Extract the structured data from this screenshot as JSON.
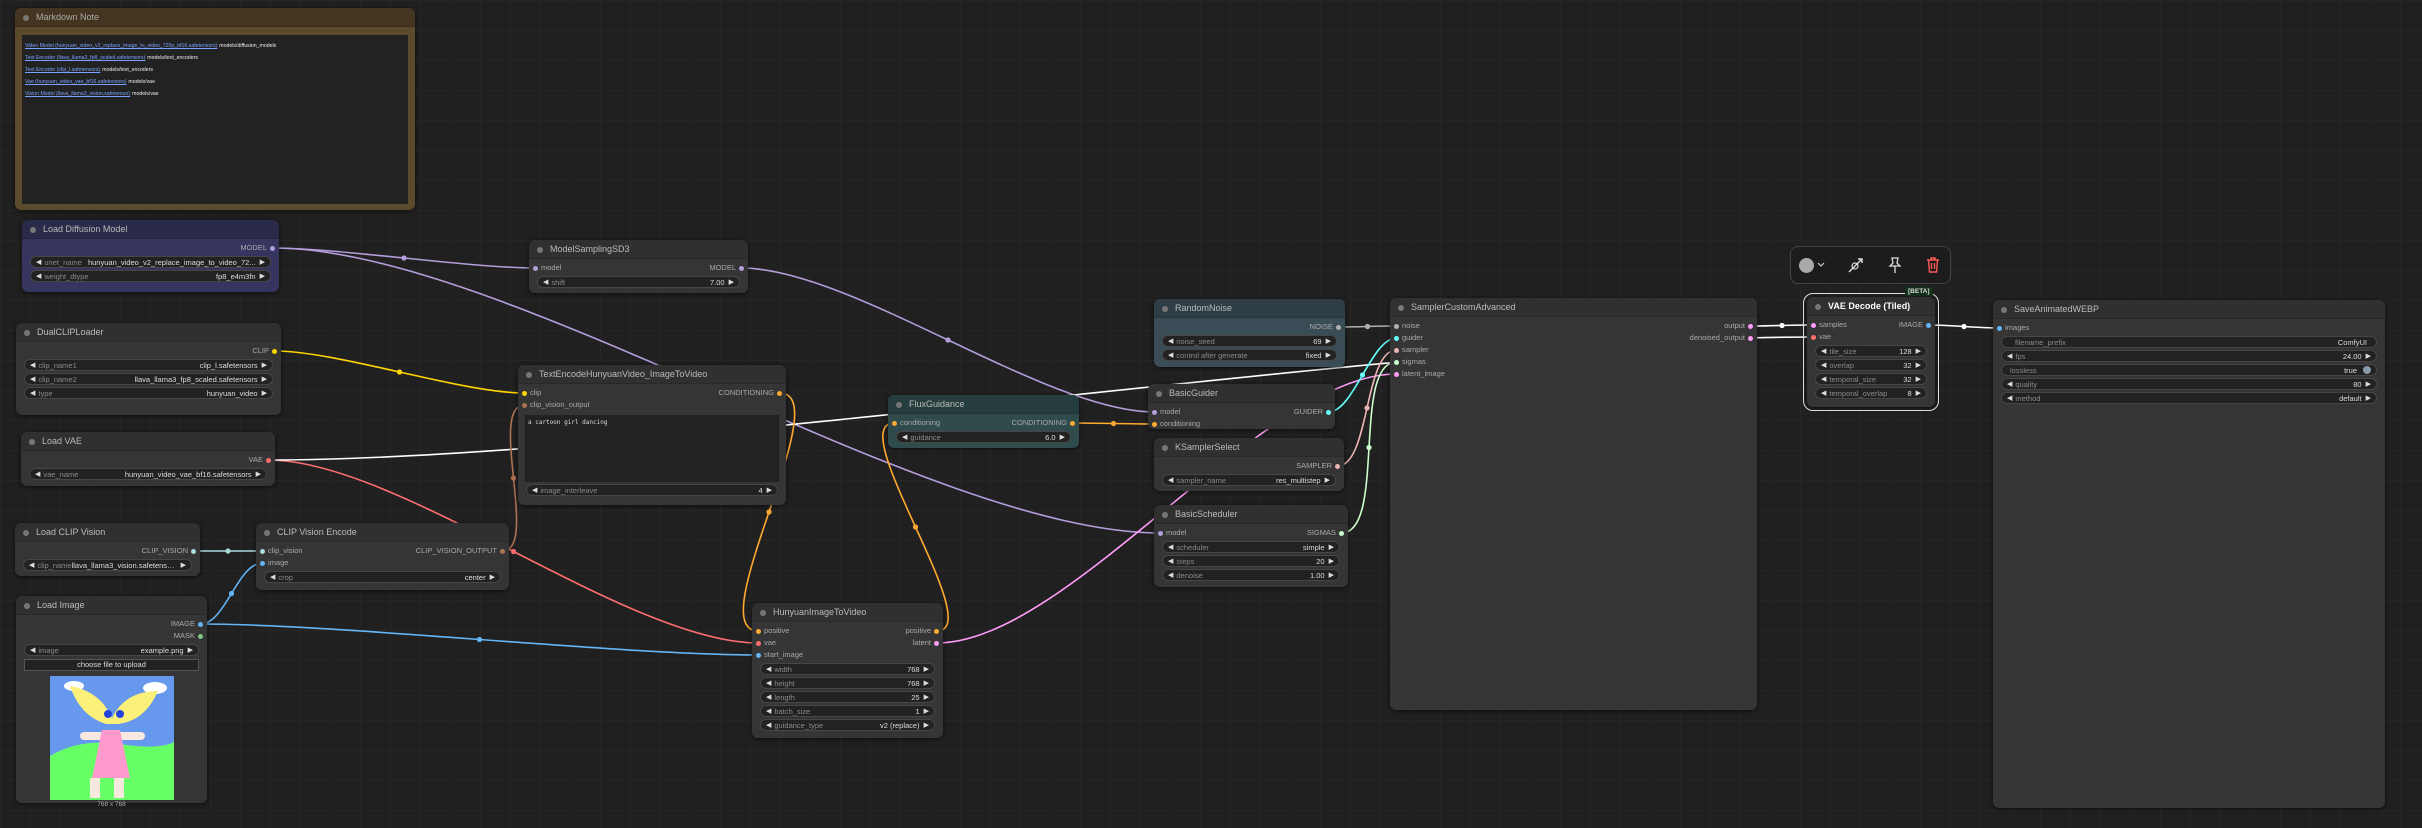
{
  "markdown_note": {
    "title": "Markdown Note",
    "lines": [
      {
        "link": "Video Model (hunyuan_video_v2_replace_image_to_video_720p_bf16.safetensors)",
        "path": "models/diffusion_models"
      },
      {
        "link": "Text Encoder (llava_llama3_fp8_scaled.safetensors)",
        "path": "models/text_encoders"
      },
      {
        "link": "Text Encoder (clip_l.safetensors)",
        "path": "models/text_encoders"
      },
      {
        "link": "Vae (hunyuan_video_vae_bf16.safetensors)",
        "path": "models/vae"
      },
      {
        "link": "Vision Model (llava_llama3_vision.safetensor)",
        "path": "models/vae"
      }
    ]
  },
  "toolbar": {
    "color_icon": "color-circle",
    "bypass_icon": "bypass-wand",
    "pin_icon": "pin",
    "delete_icon": "trash"
  },
  "badge": "[BETA]",
  "nodes": [
    {
      "id": "load-diffusion-model",
      "title": "Load Diffusion Model",
      "theme": "blue",
      "inputs": [],
      "outputs": [
        {
          "name": "MODEL",
          "type": "MODEL"
        }
      ],
      "widgets": [
        {
          "kind": "combo",
          "label": "unet_name",
          "value": "hunyuan_video_v2_replace_image_to_video_72..."
        },
        {
          "kind": "combo",
          "label": "weight_dtype",
          "value": "fp8_e4m3fn"
        }
      ]
    },
    {
      "id": "dual-clip-loader",
      "title": "DualCLIPLoader",
      "inputs": [],
      "outputs": [
        {
          "name": "CLIP",
          "type": "CLIP"
        }
      ],
      "widgets": [
        {
          "kind": "combo",
          "label": "clip_name1",
          "value": "clip_l.safetensors"
        },
        {
          "kind": "combo",
          "label": "clip_name2",
          "value": "llava_llama3_fp8_scaled.safetensors"
        },
        {
          "kind": "combo",
          "label": "type",
          "value": "hunyuan_video"
        }
      ]
    },
    {
      "id": "load-vae",
      "title": "Load VAE",
      "inputs": [],
      "outputs": [
        {
          "name": "VAE",
          "type": "VAE"
        }
      ],
      "widgets": [
        {
          "kind": "combo",
          "label": "vae_name",
          "value": "hunyuan_video_vae_bf16.safetensors"
        }
      ]
    },
    {
      "id": "load-clip-vision",
      "title": "Load CLIP Vision",
      "inputs": [],
      "outputs": [
        {
          "name": "CLIP_VISION",
          "type": "CLIP_VISION"
        }
      ],
      "widgets": [
        {
          "kind": "combo",
          "label": "clip_name",
          "value": "llava_llama3_vision.safetensors"
        }
      ]
    },
    {
      "id": "clip-vision-encode",
      "title": "CLIP Vision Encode",
      "inputs": [
        {
          "name": "clip_vision",
          "type": "CLIP_VISION"
        },
        {
          "name": "image",
          "type": "IMAGE"
        }
      ],
      "outputs": [
        {
          "name": "CLIP_VISION_OUTPUT",
          "type": "CLIP_VISION_OUTPUT"
        }
      ],
      "widgets": [
        {
          "kind": "combo",
          "label": "crop",
          "value": "center"
        }
      ]
    },
    {
      "id": "load-image",
      "title": "Load Image",
      "inputs": [],
      "outputs": [
        {
          "name": "IMAGE",
          "type": "IMAGE"
        },
        {
          "name": "MASK",
          "type": "MASK"
        }
      ],
      "widgets": [
        {
          "kind": "combo",
          "label": "image",
          "value": "example.png"
        },
        {
          "kind": "button",
          "label": "choose file to upload"
        },
        {
          "kind": "preview",
          "label": "768 x 768"
        }
      ]
    },
    {
      "id": "model-sampling-sd3",
      "title": "ModelSamplingSD3",
      "inputs": [
        {
          "name": "model",
          "type": "MODEL"
        }
      ],
      "outputs": [
        {
          "name": "MODEL",
          "type": "MODEL"
        }
      ],
      "widgets": [
        {
          "kind": "number",
          "label": "shift",
          "value": "7.00"
        }
      ]
    },
    {
      "id": "text-encode-hunyuan",
      "title": "TextEncodeHunyuanVideo_ImageToVideo",
      "inputs": [
        {
          "name": "clip",
          "type": "CLIP"
        },
        {
          "name": "clip_vision_output",
          "type": "CLIP_VISION_OUTPUT"
        }
      ],
      "outputs": [
        {
          "name": "CONDITIONING",
          "type": "CONDITIONING"
        }
      ],
      "widgets": [
        {
          "kind": "textarea",
          "value": "a cartoon girl dancing"
        },
        {
          "kind": "number",
          "label": "image_interleave",
          "value": "4"
        }
      ]
    },
    {
      "id": "hunyuan-image-to-video",
      "title": "HunyuanImageToVideo",
      "inputs": [
        {
          "name": "positive",
          "type": "CONDITIONING"
        },
        {
          "name": "vae",
          "type": "VAE"
        },
        {
          "name": "start_image",
          "type": "IMAGE"
        }
      ],
      "outputs": [
        {
          "name": "positive",
          "type": "CONDITIONING"
        },
        {
          "name": "latent",
          "type": "LATENT"
        }
      ],
      "widgets": [
        {
          "kind": "number",
          "label": "width",
          "value": "768"
        },
        {
          "kind": "number",
          "label": "height",
          "value": "768"
        },
        {
          "kind": "number",
          "label": "length",
          "value": "25"
        },
        {
          "kind": "number",
          "label": "batch_size",
          "value": "1"
        },
        {
          "kind": "combo",
          "label": "guidance_type",
          "value": "v2 (replace)"
        }
      ]
    },
    {
      "id": "flux-guidance",
      "title": "FluxGuidance",
      "theme": "teal",
      "inputs": [
        {
          "name": "conditioning",
          "type": "CONDITIONING"
        }
      ],
      "outputs": [
        {
          "name": "CONDITIONING",
          "type": "CONDITIONING"
        }
      ],
      "widgets": [
        {
          "kind": "number",
          "label": "guidance",
          "value": "6.0"
        }
      ]
    },
    {
      "id": "random-noise",
      "title": "RandomNoise",
      "theme": "slate",
      "inputs": [],
      "outputs": [
        {
          "name": "NOISE",
          "type": "NOISE"
        }
      ],
      "widgets": [
        {
          "kind": "number",
          "label": "noise_seed",
          "value": "69"
        },
        {
          "kind": "combo",
          "label": "control after generate",
          "value": "fixed"
        }
      ]
    },
    {
      "id": "basic-guider",
      "title": "BasicGuider",
      "inputs": [
        {
          "name": "model",
          "type": "MODEL"
        },
        {
          "name": "conditioning",
          "type": "CONDITIONING"
        }
      ],
      "outputs": [
        {
          "name": "GUIDER",
          "type": "GUIDER"
        }
      ],
      "widgets": []
    },
    {
      "id": "ksampler-select",
      "title": "KSamplerSelect",
      "inputs": [],
      "outputs": [
        {
          "name": "SAMPLER",
          "type": "SAMPLER"
        }
      ],
      "widgets": [
        {
          "kind": "combo",
          "label": "sampler_name",
          "value": "res_multistep"
        }
      ]
    },
    {
      "id": "basic-scheduler",
      "title": "BasicScheduler",
      "inputs": [
        {
          "name": "model",
          "type": "MODEL"
        }
      ],
      "outputs": [
        {
          "name": "SIGMAS",
          "type": "SIGMAS"
        }
      ],
      "widgets": [
        {
          "kind": "combo",
          "label": "scheduler",
          "value": "simple"
        },
        {
          "kind": "number",
          "label": "steps",
          "value": "20"
        },
        {
          "kind": "number",
          "label": "denoise",
          "value": "1.00"
        }
      ]
    },
    {
      "id": "sampler-custom-advanced",
      "title": "SamplerCustomAdvanced",
      "inputs": [
        {
          "name": "noise",
          "type": "NOISE"
        },
        {
          "name": "guider",
          "type": "GUIDER"
        },
        {
          "name": "sampler",
          "type": "SAMPLER"
        },
        {
          "name": "sigmas",
          "type": "SIGMAS"
        },
        {
          "name": "latent_image",
          "type": "LATENT"
        }
      ],
      "outputs": [
        {
          "name": "output",
          "type": "LATENT"
        },
        {
          "name": "denoised_output",
          "type": "LATENT"
        }
      ],
      "widgets": []
    },
    {
      "id": "vae-decode-tiled",
      "title": "VAE Decode (Tiled)",
      "selected": true,
      "inputs": [
        {
          "name": "samples",
          "type": "LATENT"
        },
        {
          "name": "vae",
          "type": "VAE"
        }
      ],
      "outputs": [
        {
          "name": "IMAGE",
          "type": "IMAGE"
        }
      ],
      "widgets": [
        {
          "kind": "number",
          "label": "tile_size",
          "value": "128"
        },
        {
          "kind": "number",
          "label": "overlap",
          "value": "32"
        },
        {
          "kind": "number",
          "label": "temporal_size",
          "value": "32"
        },
        {
          "kind": "number",
          "label": "temporal_overlap",
          "value": "8"
        }
      ]
    },
    {
      "id": "save-animated-webp",
      "title": "SaveAnimatedWEBP",
      "inputs": [
        {
          "name": "images",
          "type": "IMAGE"
        }
      ],
      "outputs": [],
      "widgets": [
        {
          "kind": "text",
          "label": "filename_prefix",
          "value": "ComfyUI"
        },
        {
          "kind": "number",
          "label": "fps",
          "value": "24.00"
        },
        {
          "kind": "toggle",
          "label": "lossless",
          "value": "true"
        },
        {
          "kind": "number",
          "label": "quality",
          "value": "80"
        },
        {
          "kind": "combo",
          "label": "method",
          "value": "default"
        }
      ]
    }
  ],
  "links": [
    [
      "load-diffusion-model",
      0,
      "model-sampling-sd3",
      0,
      "MODEL"
    ],
    [
      "load-diffusion-model",
      0,
      "basic-scheduler",
      0,
      "MODEL"
    ],
    [
      "model-sampling-sd3",
      0,
      "basic-guider",
      0,
      "MODEL"
    ],
    [
      "dual-clip-loader",
      0,
      "text-encode-hunyuan",
      0,
      "CLIP"
    ],
    [
      "load-vae",
      0,
      "hunyuan-image-to-video",
      1,
      "VAE"
    ],
    [
      "load-vae",
      0,
      "vae-decode-tiled",
      1,
      "VAE"
    ],
    [
      "load-clip-vision",
      0,
      "clip-vision-encode",
      0,
      "CLIP_VISION"
    ],
    [
      "load-image",
      0,
      "clip-vision-encode",
      1,
      "IMAGE"
    ],
    [
      "load-image",
      0,
      "hunyuan-image-to-video",
      2,
      "IMAGE"
    ],
    [
      "clip-vision-encode",
      0,
      "text-encode-hunyuan",
      1,
      "CLIP_VISION_OUTPUT"
    ],
    [
      "text-encode-hunyuan",
      0,
      "hunyuan-image-to-video",
      0,
      "CONDITIONING"
    ],
    [
      "hunyuan-image-to-video",
      0,
      "flux-guidance",
      0,
      "CONDITIONING"
    ],
    [
      "flux-guidance",
      0,
      "basic-guider",
      1,
      "CONDITIONING"
    ],
    [
      "hunyuan-image-to-video",
      1,
      "sampler-custom-advanced",
      4,
      "LATENT"
    ],
    [
      "random-noise",
      0,
      "sampler-custom-advanced",
      0,
      "NOISE"
    ],
    [
      "basic-guider",
      0,
      "sampler-custom-advanced",
      1,
      "GUIDER"
    ],
    [
      "ksampler-select",
      0,
      "sampler-custom-advanced",
      2,
      "SAMPLER"
    ],
    [
      "basic-scheduler",
      0,
      "sampler-custom-advanced",
      3,
      "SIGMAS"
    ],
    [
      "sampler-custom-advanced",
      0,
      "vae-decode-tiled",
      0,
      "LATENT"
    ],
    [
      "vae-decode-tiled",
      0,
      "save-animated-webp",
      0,
      "IMAGE"
    ]
  ],
  "slot_colors": {
    "MODEL": "#b39ddb",
    "CLIP": "#ffd500",
    "VAE": "#ff6e6e",
    "CLIP_VISION": "#a8dadc",
    "CLIP_VISION_OUTPUT": "#ad7452",
    "IMAGE": "#64b5f6",
    "MASK": "#81c784",
    "CONDITIONING": "#ffa931",
    "LATENT": "#ff9cf9",
    "NOISE": "#b0b0b0",
    "GUIDER": "#66ffff",
    "SAMPLER": "#ecb4b4",
    "SIGMAS": "#cdffcd"
  },
  "selected_link_color": "#ffffff"
}
